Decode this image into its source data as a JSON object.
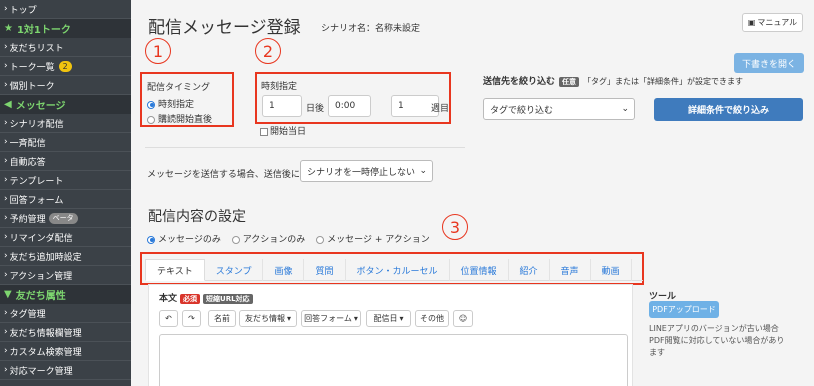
{
  "sidebar": {
    "items": [
      {
        "type": "item",
        "label": "トップ"
      },
      {
        "type": "section",
        "label": "1対1トーク",
        "icon": "star-icon"
      },
      {
        "type": "item",
        "label": "友だちリスト"
      },
      {
        "type": "item",
        "label": "トーク一覧",
        "badge": "2"
      },
      {
        "type": "item",
        "label": "個別トーク"
      },
      {
        "type": "section",
        "label": "メッセージ",
        "icon": "megaphone-icon"
      },
      {
        "type": "item",
        "label": "シナリオ配信"
      },
      {
        "type": "item",
        "label": "一斉配信"
      },
      {
        "type": "item",
        "label": "自動応答"
      },
      {
        "type": "item",
        "label": "テンプレート"
      },
      {
        "type": "item",
        "label": "回答フォーム"
      },
      {
        "type": "item",
        "label": "予約管理",
        "beta": "ベータ"
      },
      {
        "type": "item",
        "label": "リマインダ配信"
      },
      {
        "type": "item",
        "label": "友だち追加時設定"
      },
      {
        "type": "item",
        "label": "アクション管理"
      },
      {
        "type": "section",
        "label": "友だち属性",
        "icon": "filter-icon"
      },
      {
        "type": "item",
        "label": "タグ管理"
      },
      {
        "type": "item",
        "label": "友だち情報欄管理"
      },
      {
        "type": "item",
        "label": "カスタム検索管理"
      },
      {
        "type": "item",
        "label": "対応マーク管理"
      }
    ]
  },
  "header": {
    "title": "配信メッセージ登録",
    "scenario_label": "シナリオ名：名称未設定",
    "manual_label": "マニュアル"
  },
  "annotations": {
    "one": "1",
    "two": "2",
    "three": "3"
  },
  "timing": {
    "title": "配信タイミング",
    "option_time": "時刻指定",
    "option_immediate": "購読開始直後"
  },
  "time_spec": {
    "title": "時刻指定",
    "days_value": "1",
    "days_label": "日後",
    "time_value": "0:00",
    "weeks_value": "1",
    "weeks_label": "週目",
    "same_day_label": "開始当日"
  },
  "send_option": {
    "label": "メッセージを送信する場合、送信後に",
    "selected": "シナリオを一時停止しない"
  },
  "filter": {
    "title": "送信先を絞り込む",
    "optional_badge": "任意",
    "hint": "「タグ」または「詳細条件」が設定できます",
    "open_draft_label": "下書きを開く",
    "tag_select": "タグで絞り込む",
    "detail_label": "詳細条件で絞り込み"
  },
  "content": {
    "title": "配信内容の設定",
    "option_message": "メッセージのみ",
    "option_action": "アクションのみ",
    "option_both": "メッセージ + アクション"
  },
  "tabs": [
    "テキスト",
    "スタンプ",
    "画像",
    "質問",
    "ボタン・カルーセル",
    "位置情報",
    "紹介",
    "音声",
    "動画"
  ],
  "editor": {
    "body_label": "本文",
    "required_badge": "必須",
    "shorturl_badge": "短縮URL対応",
    "toolbar": {
      "undo": "↶",
      "redo": "↷",
      "name": "名前",
      "friend_info": "友だち情報",
      "answer_form": "回答フォーム",
      "delivery_date": "配信日",
      "other": "その他",
      "emoji": "☺"
    }
  },
  "tools": {
    "title": "ツール",
    "pdf_label": "PDFアップロード",
    "note": "LINEアプリのバージョンが古い場合PDF閲覧に対応していない場合があります"
  }
}
